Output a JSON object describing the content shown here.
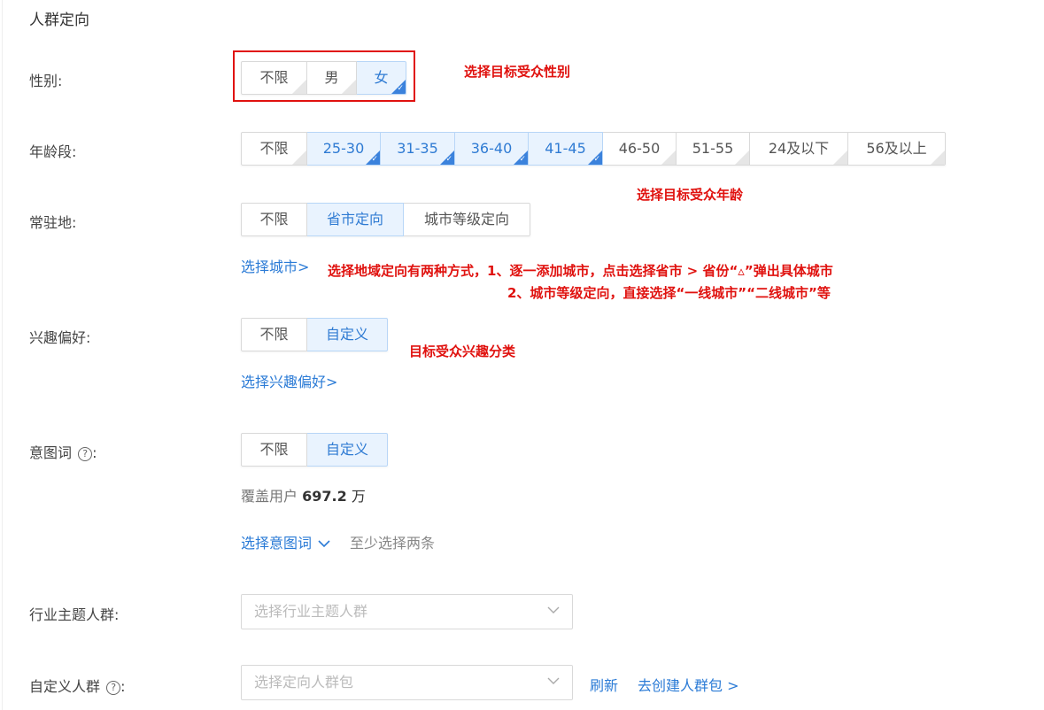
{
  "section_title": "人群定向",
  "gender": {
    "label": "性别:",
    "options": [
      {
        "label": "不限",
        "selected": false
      },
      {
        "label": "男",
        "selected": false
      },
      {
        "label": "女",
        "selected": true
      }
    ]
  },
  "age": {
    "label": "年龄段:",
    "options": [
      {
        "label": "不限",
        "selected": false
      },
      {
        "label": "25-30",
        "selected": true
      },
      {
        "label": "31-35",
        "selected": true
      },
      {
        "label": "36-40",
        "selected": true
      },
      {
        "label": "41-45",
        "selected": true
      },
      {
        "label": "46-50",
        "selected": false
      },
      {
        "label": "51-55",
        "selected": false
      },
      {
        "label": "24及以下",
        "selected": false
      },
      {
        "label": "56及以上",
        "selected": false
      }
    ]
  },
  "residence": {
    "label": "常驻地:",
    "options": [
      {
        "label": "不限",
        "selected": false
      },
      {
        "label": "省市定向",
        "selected": true
      },
      {
        "label": "城市等级定向",
        "selected": false
      }
    ],
    "link": "选择城市>"
  },
  "interest": {
    "label": "兴趣偏好:",
    "options": [
      {
        "label": "不限",
        "selected": false
      },
      {
        "label": "自定义",
        "selected": true
      }
    ],
    "link": "选择兴趣偏好>"
  },
  "intent": {
    "label": "意图词",
    "label_suffix": ":",
    "help_icon": "question-circle-icon",
    "options": [
      {
        "label": "不限",
        "selected": false
      },
      {
        "label": "自定义",
        "selected": true
      }
    ],
    "coverage_prefix": "覆盖用户",
    "coverage_value": "697.2",
    "coverage_unit": "万",
    "link": "选择意图词",
    "link_icon": "chevron-down-icon",
    "hint": "至少选择两条"
  },
  "industry": {
    "label": "行业主题人群:",
    "placeholder": "选择行业主题人群"
  },
  "custom": {
    "label": "自定义人群",
    "label_suffix": ":",
    "help_icon": "question-circle-icon",
    "placeholder": "选择定向人群包",
    "refresh": "刷新",
    "create": "去创建人群包 >"
  },
  "annotations": {
    "gender": "选择目标受众性别",
    "age": "选择目标受众年龄",
    "region_line1": "选择地域定向有两种方式，1、逐一添加城市，点击选择省市 > 省份“▵”弹出具体城市",
    "region_line2": "2、城市等级定向，直接选择“一线城市”“二线城市”等",
    "interest": "目标受众兴趣分类"
  },
  "colors": {
    "accent": "#2b7bd6",
    "selected_bg": "#e9f3fe",
    "annotation": "#e0120f"
  }
}
